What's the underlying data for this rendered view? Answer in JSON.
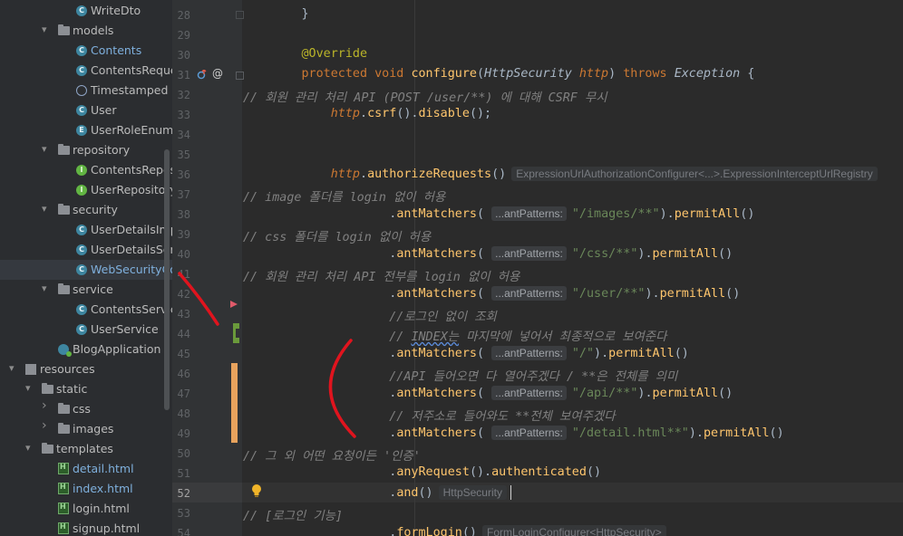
{
  "tree": [
    {
      "label": "WriteDto",
      "icon": "cls",
      "indent": 84
    },
    {
      "label": "models",
      "icon": "folder",
      "indent": 64,
      "arrow": "down"
    },
    {
      "label": "Contents",
      "icon": "cls",
      "indent": 84,
      "accent": "#7fb0dd"
    },
    {
      "label": "ContentsRequest",
      "icon": "cls",
      "indent": 84
    },
    {
      "label": "Timestamped",
      "icon": "ann",
      "indent": 84
    },
    {
      "label": "User",
      "icon": "cls",
      "indent": 84
    },
    {
      "label": "UserRoleEnum",
      "icon": "enm",
      "indent": 84
    },
    {
      "label": "repository",
      "icon": "folder",
      "indent": 64,
      "arrow": "down"
    },
    {
      "label": "ContentsRepository",
      "icon": "intf",
      "indent": 84
    },
    {
      "label": "UserRepository",
      "icon": "intf",
      "indent": 84
    },
    {
      "label": "security",
      "icon": "folder",
      "indent": 64,
      "arrow": "down"
    },
    {
      "label": "UserDetailsImpl",
      "icon": "cls",
      "indent": 84
    },
    {
      "label": "UserDetailsService",
      "icon": "cls",
      "indent": 84
    },
    {
      "label": "WebSecurityConfig",
      "icon": "cls",
      "indent": 84,
      "selected": true,
      "accent": "#7fb0dd"
    },
    {
      "label": "service",
      "icon": "folder",
      "indent": 64,
      "arrow": "down"
    },
    {
      "label": "ContentsService",
      "icon": "cls",
      "indent": 84
    },
    {
      "label": "UserService",
      "icon": "cls",
      "indent": 84
    },
    {
      "label": "BlogApplication",
      "icon": "app",
      "indent": 64
    },
    {
      "label": "resources",
      "icon": "res",
      "indent": 28,
      "arrow": "down"
    },
    {
      "label": "static",
      "icon": "folder",
      "indent": 46,
      "arrow": "down"
    },
    {
      "label": "css",
      "icon": "folder",
      "indent": 64,
      "arrow": "right"
    },
    {
      "label": "images",
      "icon": "folder",
      "indent": 64,
      "arrow": "right"
    },
    {
      "label": "templates",
      "icon": "folder",
      "indent": 46,
      "arrow": "down"
    },
    {
      "label": "detail.html",
      "icon": "html",
      "indent": 64,
      "accent": "#7fb0dd"
    },
    {
      "label": "index.html",
      "icon": "html",
      "indent": 64,
      "accent": "#7fb0dd"
    },
    {
      "label": "login.html",
      "icon": "html",
      "indent": 64
    },
    {
      "label": "signup.html",
      "icon": "html",
      "indent": 64
    }
  ],
  "editor": {
    "current_line": "52",
    "lines": [
      {
        "n": "28",
        "indent": 0,
        "segs": [
          {
            "t": "        }",
            "c": ""
          }
        ]
      },
      {
        "n": "29",
        "indent": 0,
        "segs": []
      },
      {
        "n": "30",
        "indent": 0,
        "segs": [
          {
            "t": "        ",
            "c": ""
          },
          {
            "t": "@Override",
            "c": "ann-t"
          }
        ]
      },
      {
        "n": "31",
        "indent": 0,
        "segs": [
          {
            "t": "        ",
            "c": ""
          },
          {
            "t": "protected void ",
            "c": "kw"
          },
          {
            "t": "configure",
            "c": "fn"
          },
          {
            "t": "(",
            "c": ""
          },
          {
            "t": "HttpSecurity ",
            "c": "typ"
          },
          {
            "t": "http",
            "c": "param"
          },
          {
            "t": ") ",
            "c": ""
          },
          {
            "t": "throws ",
            "c": "kw"
          },
          {
            "t": "Exception",
            "c": "typ"
          },
          {
            "t": " {",
            "c": ""
          }
        ]
      },
      {
        "n": "32",
        "indent": 0,
        "cmt": true,
        "segs": [
          {
            "t": "// 회원 관리 처리 API (POST /user/**) 에 대해 CSRF 무시",
            "c": ""
          }
        ]
      },
      {
        "n": "33",
        "indent": 0,
        "segs": [
          {
            "t": "            ",
            "c": ""
          },
          {
            "t": "http",
            "c": "param"
          },
          {
            "t": ".",
            "c": ""
          },
          {
            "t": "csrf",
            "c": "fn"
          },
          {
            "t": "().",
            "c": ""
          },
          {
            "t": "disable",
            "c": "fn"
          },
          {
            "t": "();",
            "c": ""
          }
        ]
      },
      {
        "n": "34",
        "indent": 0,
        "segs": []
      },
      {
        "n": "35",
        "indent": 0,
        "segs": []
      },
      {
        "n": "36",
        "indent": 0,
        "segs": [
          {
            "t": "            ",
            "c": ""
          },
          {
            "t": "http",
            "c": "param"
          },
          {
            "t": ".",
            "c": ""
          },
          {
            "t": "authorizeRequests",
            "c": "fn"
          },
          {
            "t": "()",
            "c": ""
          },
          {
            "t": "ExpressionUrlAuthorizationConfigurer<...>.ExpressionInterceptUrlRegistry",
            "c": "hint-after"
          }
        ]
      },
      {
        "n": "37",
        "indent": 0,
        "cmt": true,
        "segs": [
          {
            "t": "// image 폴더를 login 없이 허용",
            "c": ""
          }
        ]
      },
      {
        "n": "38",
        "indent": 0,
        "segs": [
          {
            "t": "                    .",
            "c": ""
          },
          {
            "t": "antMatchers",
            "c": "fn"
          },
          {
            "t": "( ",
            "c": ""
          },
          {
            "t": "...antPatterns:",
            "c": "hint"
          },
          {
            "t": "\"/images/**\"",
            "c": "str"
          },
          {
            "t": ").",
            "c": ""
          },
          {
            "t": "permitAll",
            "c": "fn"
          },
          {
            "t": "()",
            "c": ""
          }
        ]
      },
      {
        "n": "39",
        "indent": 0,
        "cmt": true,
        "segs": [
          {
            "t": "// css 폴더를 login 없이 허용",
            "c": ""
          }
        ]
      },
      {
        "n": "40",
        "indent": 0,
        "segs": [
          {
            "t": "                    .",
            "c": ""
          },
          {
            "t": "antMatchers",
            "c": "fn"
          },
          {
            "t": "( ",
            "c": ""
          },
          {
            "t": "...antPatterns:",
            "c": "hint"
          },
          {
            "t": "\"/css/**\"",
            "c": "str"
          },
          {
            "t": ").",
            "c": ""
          },
          {
            "t": "permitAll",
            "c": "fn"
          },
          {
            "t": "()",
            "c": ""
          }
        ]
      },
      {
        "n": "41",
        "indent": 0,
        "cmt": true,
        "segs": [
          {
            "t": "// 회원 관리 처리 API 전부를 login 없이 허용",
            "c": ""
          }
        ]
      },
      {
        "n": "42",
        "indent": 0,
        "segs": [
          {
            "t": "                    .",
            "c": ""
          },
          {
            "t": "antMatchers",
            "c": "fn"
          },
          {
            "t": "( ",
            "c": ""
          },
          {
            "t": "...antPatterns:",
            "c": "hint"
          },
          {
            "t": "\"/user/**\"",
            "c": "str"
          },
          {
            "t": ").",
            "c": ""
          },
          {
            "t": "permitAll",
            "c": "fn"
          },
          {
            "t": "()",
            "c": ""
          }
        ]
      },
      {
        "n": "43",
        "indent": 0,
        "cmt": true,
        "segs": [
          {
            "t": "                    //로그인 없이 조회",
            "c": ""
          }
        ]
      },
      {
        "n": "44",
        "indent": 0,
        "cmt": true,
        "segs": [
          {
            "t": "                    // ",
            "c": ""
          },
          {
            "t": "INDEX는",
            "c": "squig"
          },
          {
            "t": " 마지막에 넣어서 최종적으로 보여준다",
            "c": ""
          }
        ]
      },
      {
        "n": "45",
        "indent": 0,
        "segs": [
          {
            "t": "                    .",
            "c": ""
          },
          {
            "t": "antMatchers",
            "c": "fn"
          },
          {
            "t": "( ",
            "c": ""
          },
          {
            "t": "...antPatterns:",
            "c": "hint"
          },
          {
            "t": "\"/\"",
            "c": "str"
          },
          {
            "t": ").",
            "c": ""
          },
          {
            "t": "permitAll",
            "c": "fn"
          },
          {
            "t": "()",
            "c": ""
          }
        ]
      },
      {
        "n": "46",
        "indent": 0,
        "cmt": true,
        "segs": [
          {
            "t": "                    //API 들어오면 다 열어주겠다 / **은 전체를 의미",
            "c": ""
          }
        ]
      },
      {
        "n": "47",
        "indent": 0,
        "segs": [
          {
            "t": "                    .",
            "c": ""
          },
          {
            "t": "antMatchers",
            "c": "fn"
          },
          {
            "t": "( ",
            "c": ""
          },
          {
            "t": "...antPatterns:",
            "c": "hint"
          },
          {
            "t": "\"/api/**\"",
            "c": "str"
          },
          {
            "t": ").",
            "c": ""
          },
          {
            "t": "permitAll",
            "c": "fn"
          },
          {
            "t": "()",
            "c": ""
          }
        ]
      },
      {
        "n": "48",
        "indent": 0,
        "cmt": true,
        "segs": [
          {
            "t": "                    // 저주소로 들어와도 **전체 보여주겠다",
            "c": ""
          }
        ]
      },
      {
        "n": "49",
        "indent": 0,
        "segs": [
          {
            "t": "                    .",
            "c": ""
          },
          {
            "t": "antMatchers",
            "c": "fn"
          },
          {
            "t": "( ",
            "c": ""
          },
          {
            "t": "...antPatterns:",
            "c": "hint"
          },
          {
            "t": "\"/detail.html**\"",
            "c": "str"
          },
          {
            "t": ").",
            "c": ""
          },
          {
            "t": "permitAll",
            "c": "fn"
          },
          {
            "t": "()",
            "c": ""
          }
        ]
      },
      {
        "n": "50",
        "indent": 0,
        "cmt": true,
        "segs": [
          {
            "t": "// 그 외 어떤 요청이든 '인증'",
            "c": ""
          }
        ]
      },
      {
        "n": "51",
        "indent": 0,
        "segs": [
          {
            "t": "                    .",
            "c": ""
          },
          {
            "t": "anyRequest",
            "c": "fn"
          },
          {
            "t": "().",
            "c": ""
          },
          {
            "t": "authenticated",
            "c": "fn"
          },
          {
            "t": "()",
            "c": ""
          }
        ]
      },
      {
        "n": "52",
        "indent": 0,
        "segs": [
          {
            "t": "                    .",
            "c": ""
          },
          {
            "t": "and",
            "c": "fn"
          },
          {
            "t": "()",
            "c": ""
          },
          {
            "t": "HttpSecurity",
            "c": "hint-after"
          }
        ],
        "cursor": true
      },
      {
        "n": "53",
        "indent": 0,
        "cmt": true,
        "segs": [
          {
            "t": "// [로그인 기능]",
            "c": ""
          }
        ]
      },
      {
        "n": "54",
        "indent": 0,
        "segs": [
          {
            "t": "                    .",
            "c": ""
          },
          {
            "t": "formLogin",
            "c": "fn"
          },
          {
            "t": "()",
            "c": ""
          },
          {
            "t": "FormLoginConfigurer<HttpSecurity>",
            "c": "hint-after"
          }
        ]
      }
    ]
  },
  "colors": {
    "annotation_red": "#e0141e",
    "vcs_added": "#6a9a3b",
    "vcs_modified": "#e8a35d"
  },
  "icons": [
    "class-icon",
    "interface-icon",
    "folder-icon",
    "html-file-icon",
    "override-icon",
    "annotation-icon",
    "lightbulb-icon",
    "breakpoint-arrow-icon"
  ]
}
